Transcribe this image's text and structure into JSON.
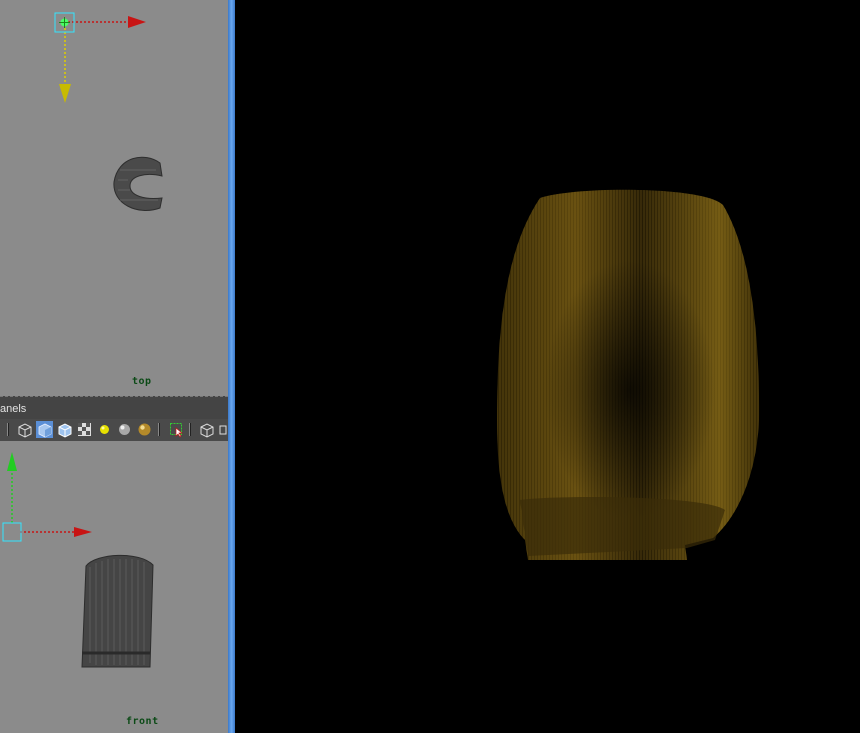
{
  "viewports": {
    "top": {
      "label": "top"
    },
    "front": {
      "label": "front"
    }
  },
  "panel_menu": {
    "label": "anels"
  },
  "toolbar": {
    "icons": [
      "wireframe-cube-icon",
      "smooth-shade-cube-icon",
      "shaded-wireframe-cube-icon",
      "texture-checker-icon",
      "default-light-icon",
      "all-lights-sphere-icon",
      "shadows-sphere-icon",
      "isolate-select-icon",
      "xray-cube-icon"
    ]
  },
  "colors": {
    "viewport_bg": "#8b8b8b",
    "label_green": "#0b4a16",
    "splitter_blue": "#4f90dc",
    "hair_gold": "#b08a20",
    "x_axis": "#cc1111",
    "y_axis_top": "#e8d400",
    "y_axis_front": "#22cc22"
  }
}
